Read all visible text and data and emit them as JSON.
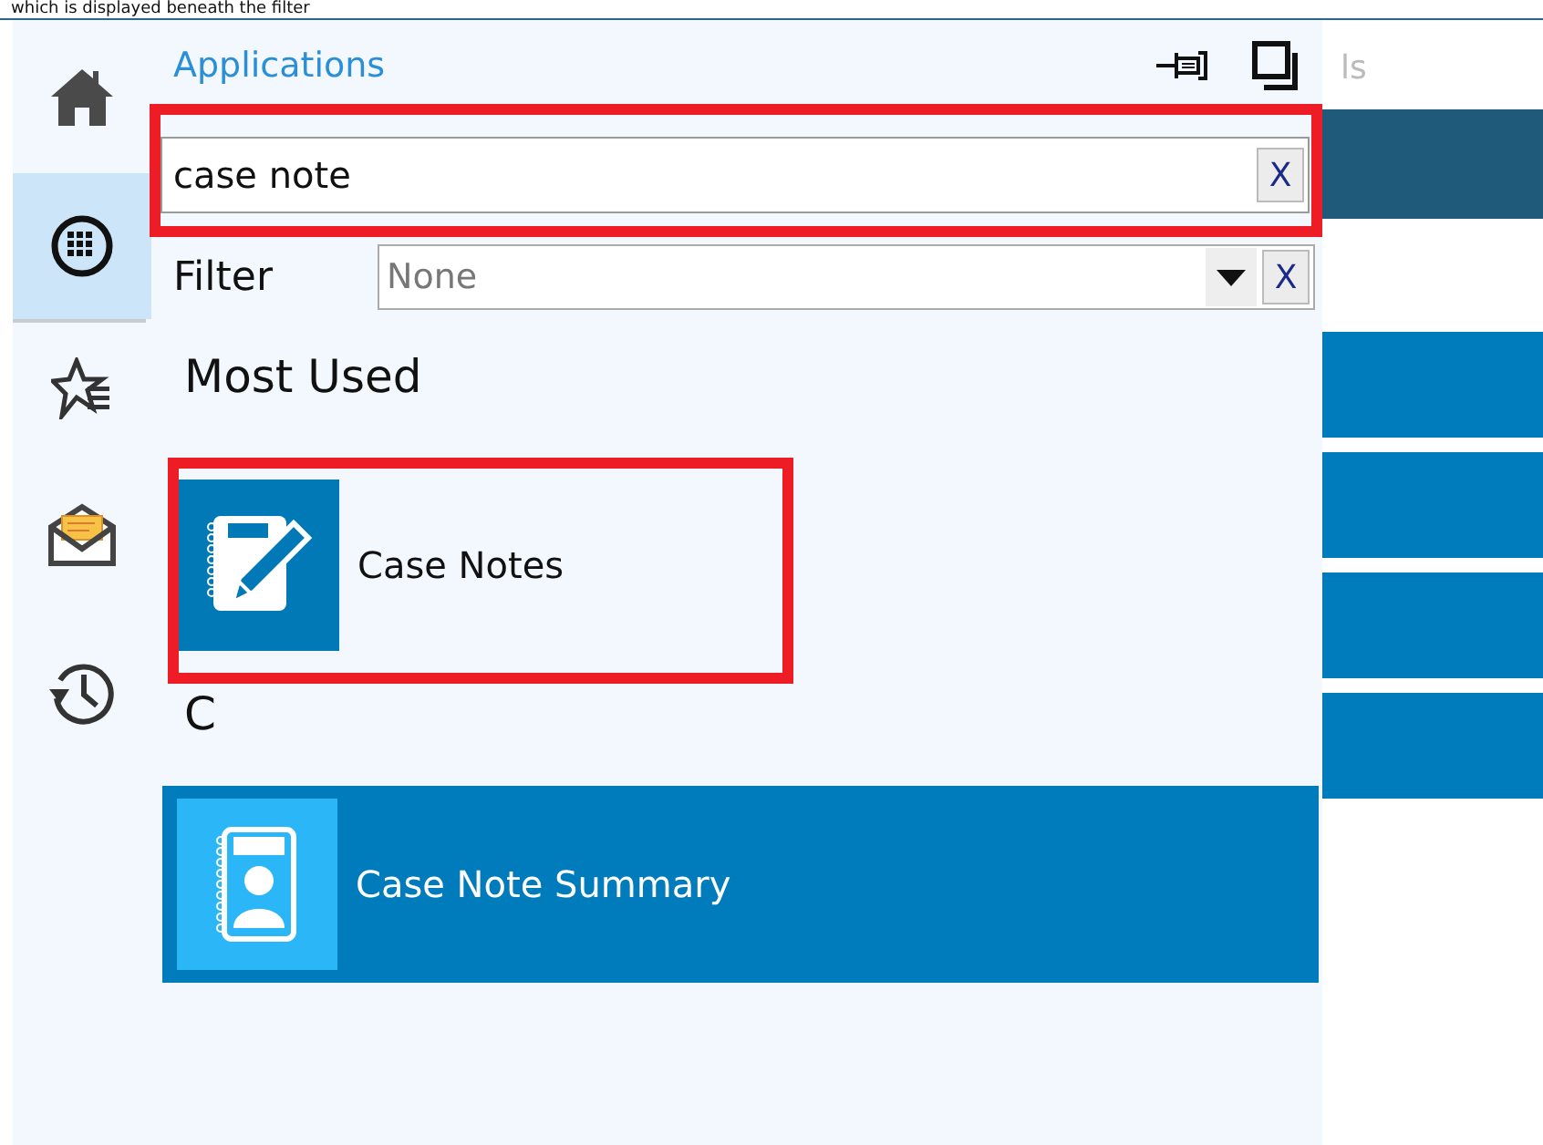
{
  "caption": "which is displayed beneath the filter",
  "sidebar": {
    "items": [
      {
        "kind": "home",
        "selected": false
      },
      {
        "kind": "apps",
        "selected": true
      },
      {
        "kind": "favorites",
        "selected": false
      },
      {
        "kind": "messages",
        "selected": false
      },
      {
        "kind": "history",
        "selected": false
      }
    ]
  },
  "panel": {
    "title": "Applications",
    "search": {
      "value": "case note",
      "clear": "X",
      "highlighted": true
    },
    "filter": {
      "label": "Filter",
      "value": "None",
      "clear": "X"
    },
    "groups": [
      {
        "header": "Most Used",
        "items": [
          {
            "label": "Case Notes",
            "kind": "notes",
            "selected": false,
            "highlighted": true
          }
        ]
      },
      {
        "header": "C",
        "items": [
          {
            "label": "Case Note Summary",
            "kind": "summary",
            "selected": true,
            "highlighted": false
          }
        ]
      }
    ]
  },
  "background_window": {
    "title_fragment": "ls"
  }
}
